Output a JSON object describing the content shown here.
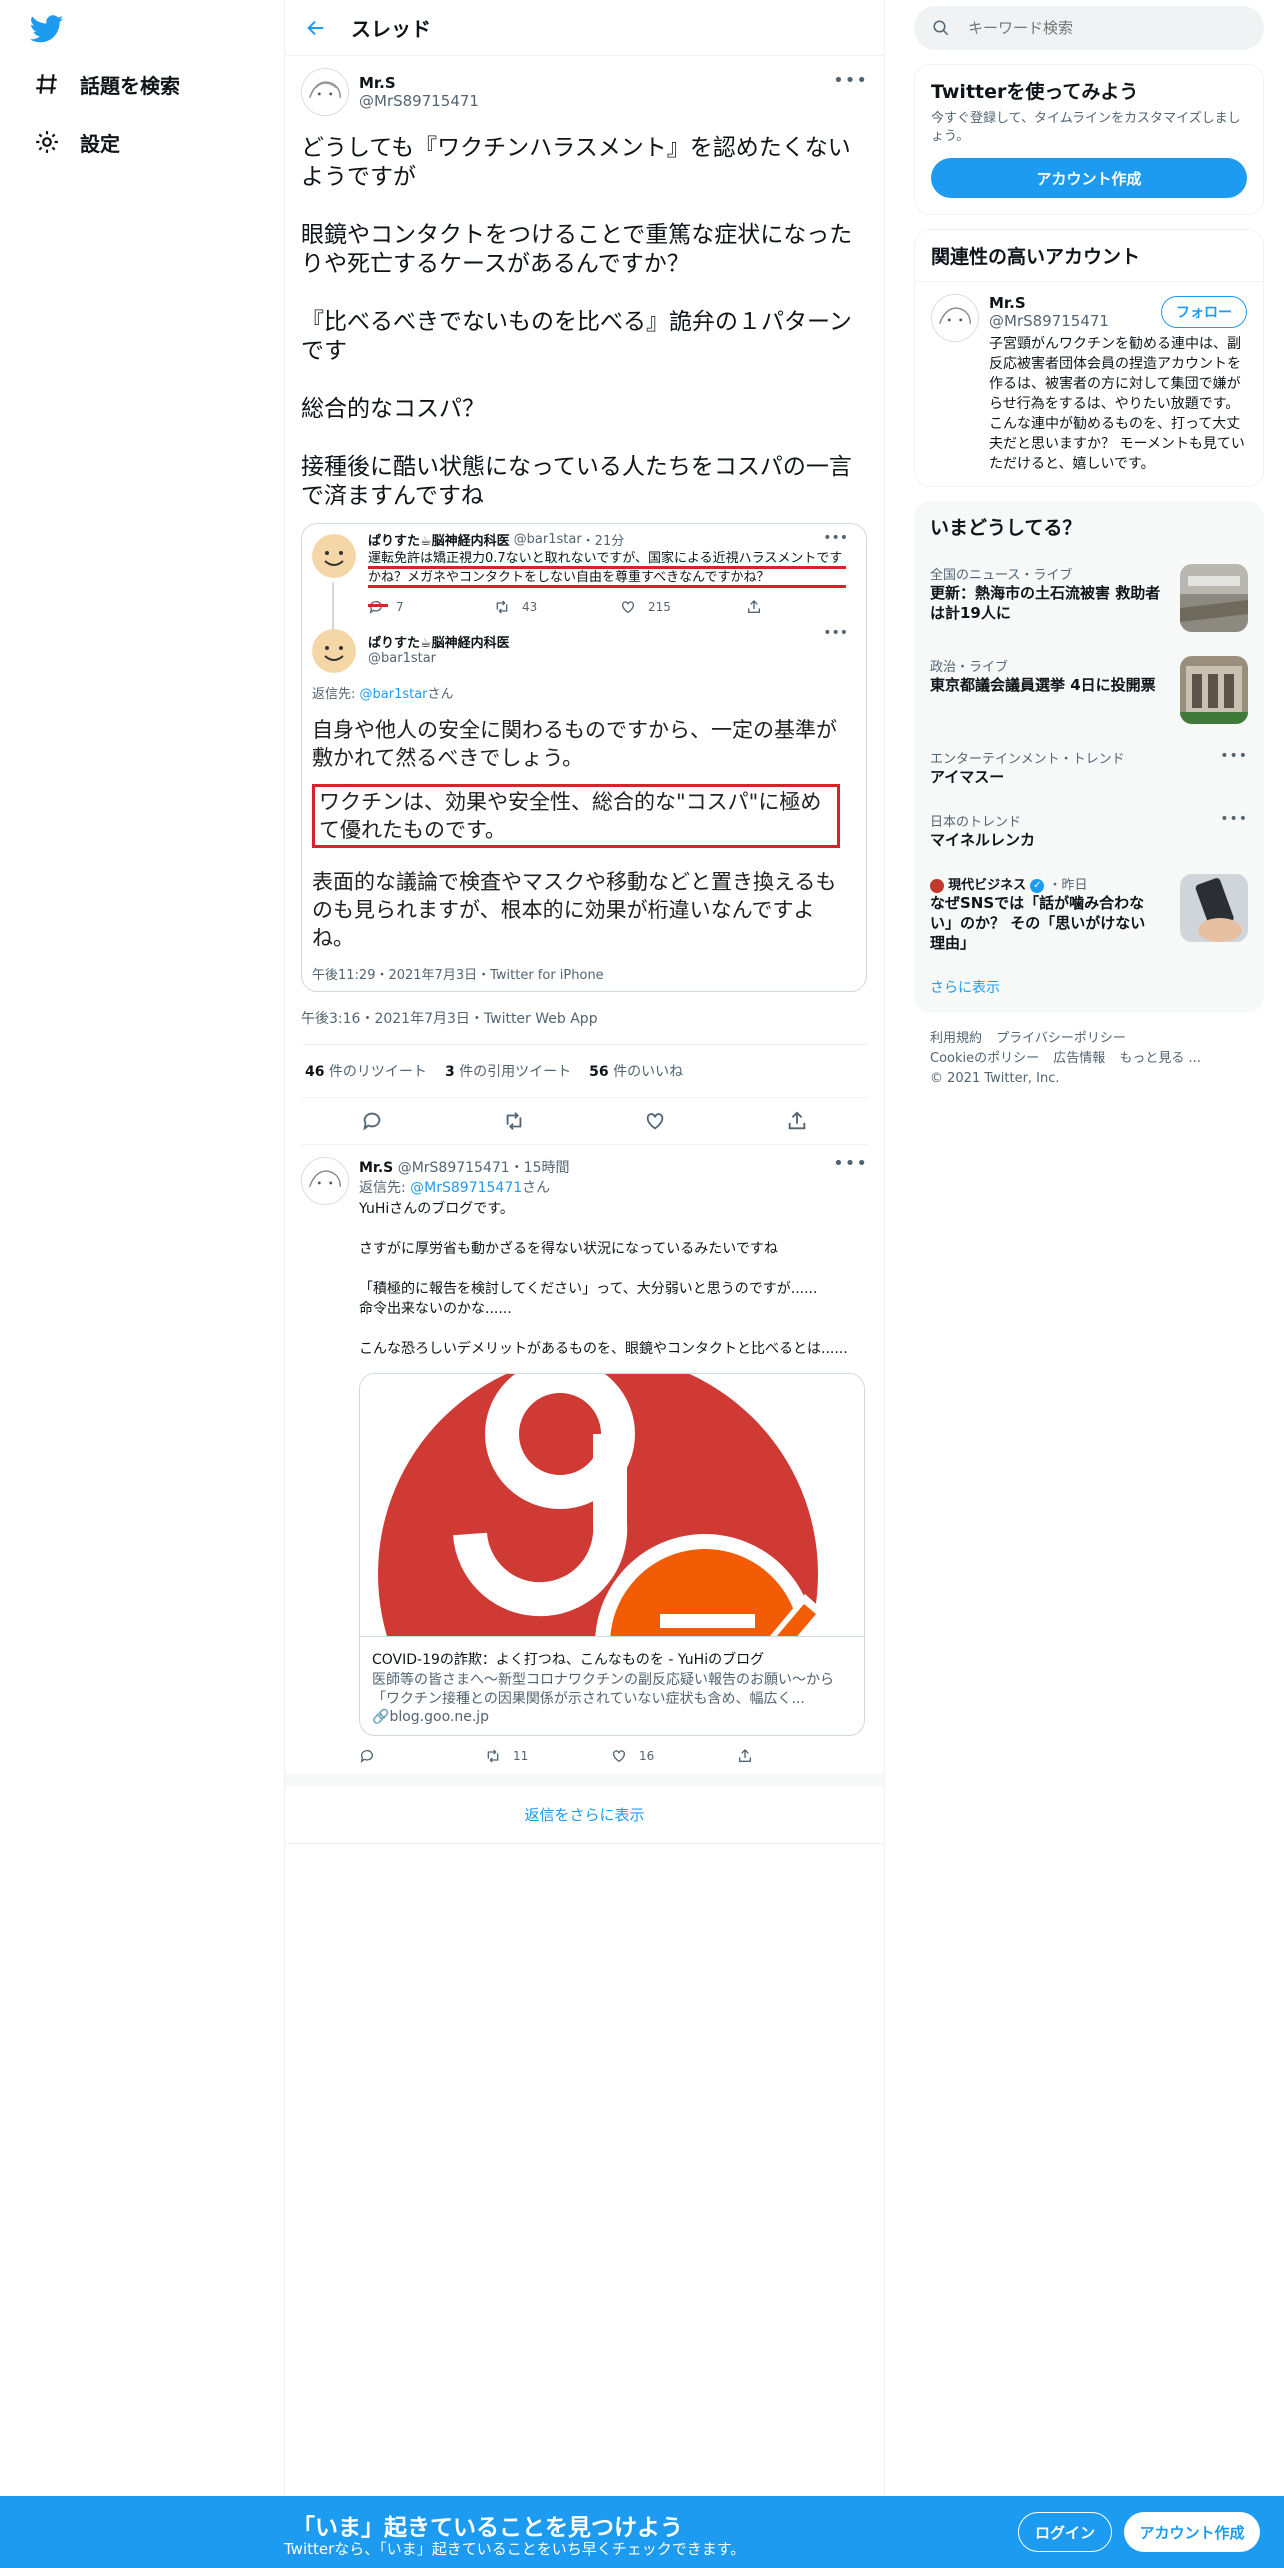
{
  "nav": {
    "explore_label": "話題を検索",
    "settings_label": "設定"
  },
  "header": {
    "title": "スレッド"
  },
  "main_tweet": {
    "name": "Mr.S",
    "handle": "@MrS89715471",
    "text": "どうしても『ワクチンハラスメント』を認めたくないようですが\n\n眼鏡やコンタクトをつけることで重篤な症状になったりや死亡するケースがあるんですか？\n\n『比べるべきでないものを比べる』詭弁の１パターンです\n\n総合的なコスパ？\n\n接種後に酷い状態になっている人たちをコスパの一言で済ますんですね",
    "time": "午後3:16・2021年7月3日・Twitter Web App",
    "stats": {
      "retweets_count": "46",
      "retweets_label": " 件のリツイート",
      "quotes_count": "3",
      "quotes_label": " 件の引用ツイート",
      "likes_count": "56",
      "likes_label": " 件のいいね"
    }
  },
  "quoted": {
    "first": {
      "name": "ぱりすた☕脳神経内科医",
      "handle": "@bar1star",
      "age": "・21分",
      "text": "運転免許は矯正視力0.7ないと取れないですが、国家による近視ハラスメントですかね？メガネやコンタクトをしない自由を尊重すべきなんですかね？",
      "reply_count": "7",
      "retweet_count": "43",
      "like_count": "215"
    },
    "second": {
      "name": "ぱりすた☕脳神経内科医",
      "handle": "@bar1star",
      "reply_prefix": "返信先: ",
      "reply_target": "@bar1star",
      "reply_suffix": "さん",
      "para1": "自身や他人の安全に関わるものですから、一定の基準が敷かれて然るべきでしょう。",
      "para2": "ワクチンは、効果や安全性、総合的な\"コスパ\"に極めて優れたものです。",
      "para3": "表面的な議論で検査やマスクや移動などと置き換えるものも見られますが、根本的に効果が桁違いなんですよね。",
      "date": "午後11:29・2021年7月3日・Twitter for iPhone"
    }
  },
  "reply": {
    "name": "Mr.S",
    "handle": "@MrS89715471",
    "age": "・15時間",
    "reply_prefix": "返信先: ",
    "reply_target": "@MrS89715471",
    "reply_suffix": "さん",
    "text": "YuHiさんのブログです。\n\nさすがに厚労省も動かざるを得ない状況になっているみたいですね\n\n「積極的に報告を検討してください」って、大分弱いと思うのですが......\n命令出来ないのかな......\n\nこんな恐ろしいデメリットがあるものを、眼鏡やコンタクトと比べるとは......",
    "card_title": "COVID-19の詐欺：よく打つね、こんなものを - YuHiのブログ",
    "card_desc": "医師等の皆さまへ～新型コロナワクチンの副反応疑い報告のお願い～から「ワクチン接種との因果関係が示されていない症状も含め、幅広く...",
    "card_domain": "blog.goo.ne.jp",
    "reply_count": "",
    "retweet_count": "11",
    "like_count": "16"
  },
  "show_more_replies": "返信をさらに表示",
  "sidebar": {
    "search_placeholder": "キーワード検索",
    "try": {
      "title": "Twitterを使ってみよう",
      "subtitle": "今すぐ登録して、タイムラインをカスタマイズしましょう。",
      "button": "アカウント作成"
    },
    "related": {
      "title": "関連性の高いアカウント",
      "name": "Mr.S",
      "handle": "@MrS89715471",
      "follow": "フォロー",
      "bio": "子宮頸がんワクチンを勧める連中は、副反応被害者団体会員の捏造アカウントを作るは、被害者の方に対して集団で嫌がらせ行為をするは、やりたい放題です。 こんな連中が勧めるものを、打って大丈夫だと思いますか？ モーメントも見ていただけると、嬉しいです。"
    },
    "trends": {
      "title": "いまどうしてる？",
      "items": [
        {
          "meta": "全国のニュース・ライブ",
          "title": "更新：熱海市の土石流被害 救助者は計19人に"
        },
        {
          "meta": "政治・ライブ",
          "title": "東京都議会議員選挙 4日に投開票"
        },
        {
          "meta": "エンターテインメント・トレンド",
          "title": "アイマスー"
        },
        {
          "meta": "日本のトレンド",
          "title": "マイネルレンカ"
        },
        {
          "meta_source": "現代ビジネス",
          "meta_time": "・昨日",
          "title": "なぜSNSでは「話が噛み合わない」のか？ その「思いがけない理由」"
        }
      ],
      "show_more": "さらに表示"
    },
    "footer": {
      "terms": "利用規約",
      "privacy": "プライバシーポリシー",
      "cookie": "Cookieのポリシー",
      "ads": "広告情報",
      "more": "もっと見る ...",
      "copyright": "© 2021 Twitter, Inc."
    }
  },
  "bottom_bar": {
    "title": "「いま」起きていることを見つけよう",
    "subtitle": "Twitterなら、「いま」起きていることをいち早くチェックできます。",
    "login": "ログイン",
    "signup": "アカウント作成"
  },
  "colors": {
    "accent": "#1d9bf0",
    "highlight": "#d8232a"
  },
  "icons": [
    "twitter-logo-icon",
    "hashtag-icon",
    "gear-icon",
    "back-arrow-icon",
    "search-icon",
    "reply-icon",
    "retweet-icon",
    "like-icon",
    "share-icon",
    "link-icon",
    "verified-icon"
  ]
}
